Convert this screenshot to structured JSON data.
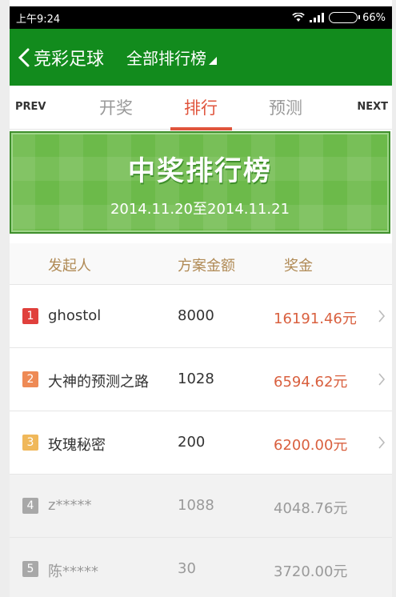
{
  "status_bar": {
    "time": "上午9:24",
    "battery": "66%",
    "battery_level": 0.66
  },
  "header": {
    "back_label": "竞彩足球",
    "subtitle": "全部排行榜"
  },
  "tabs": {
    "prev": "PREV",
    "next": "NEXT",
    "items": [
      "开奖",
      "排行",
      "预测"
    ],
    "active": "排行"
  },
  "banner": {
    "title": "中奖排行榜",
    "date": "2014.11.20至2014.11.21"
  },
  "table": {
    "headers": [
      "发起人",
      "方案金额",
      "奖金"
    ],
    "rows": [
      {
        "rank": "1",
        "name": "ghostol",
        "amount": "8000",
        "prize": "16191.46元",
        "rank_color": "#e0403c"
      },
      {
        "rank": "2",
        "name": "大神的预测之路",
        "amount": "1028",
        "prize": "6594.62元",
        "rank_color": "#ee8a55"
      },
      {
        "rank": "3",
        "name": "玫瑰秘密",
        "amount": "200",
        "prize": "6200.00元",
        "rank_color": "#f0b85a"
      },
      {
        "rank": "4",
        "name": "z*****",
        "amount": "1088",
        "prize": "4048.76元",
        "rank_color": "#a8a8a8"
      },
      {
        "rank": "5",
        "name": "陈*****",
        "amount": "30",
        "prize": "3720.00元",
        "rank_color": "#a8a8a8"
      }
    ]
  },
  "colors": {
    "header_green": "#128b1d",
    "accent_red": "#e0543c",
    "prize_red": "#d9603f"
  }
}
